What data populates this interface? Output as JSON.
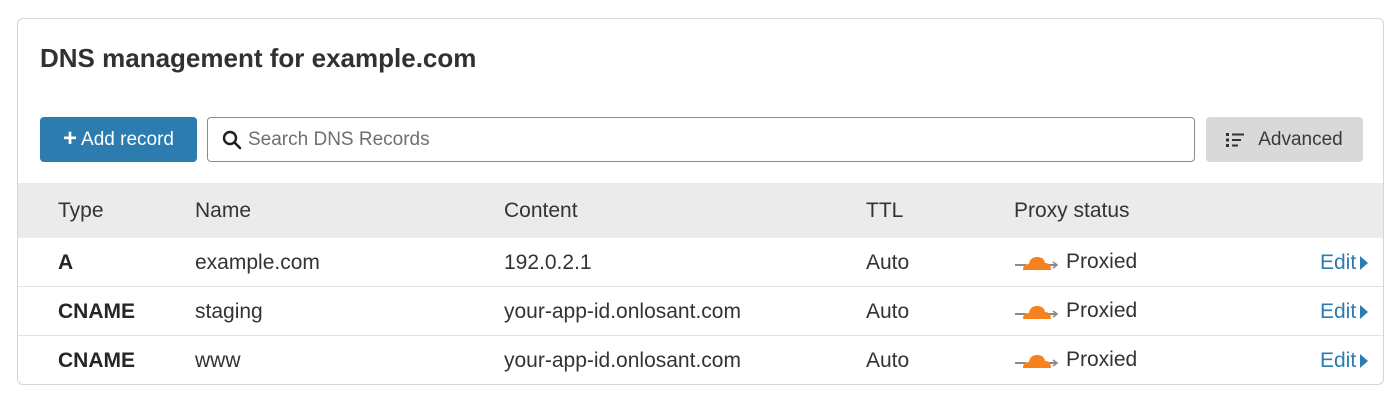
{
  "header": {
    "title_prefix": "DNS management for",
    "domain": "example.com"
  },
  "toolbar": {
    "add_record_label": "Add record",
    "search_placeholder": "Search DNS Records",
    "search_value": "",
    "advanced_label": "Advanced"
  },
  "table": {
    "columns": {
      "type": "Type",
      "name": "Name",
      "content": "Content",
      "ttl": "TTL",
      "proxy_status": "Proxy status"
    },
    "rows": [
      {
        "type": "A",
        "name": "example.com",
        "content": "192.0.2.1",
        "ttl": "Auto",
        "proxy_status": "Proxied",
        "edit": "Edit"
      },
      {
        "type": "CNAME",
        "name": "staging",
        "content": "your-app-id.onlosant.com",
        "ttl": "Auto",
        "proxy_status": "Proxied",
        "edit": "Edit"
      },
      {
        "type": "CNAME",
        "name": "www",
        "content": "your-app-id.onlosant.com",
        "ttl": "Auto",
        "proxy_status": "Proxied",
        "edit": "Edit"
      }
    ]
  },
  "colors": {
    "primary": "#2c7cb0",
    "cloud_orange": "#f6821f",
    "header_bg": "#ebebeb",
    "advanced_bg": "#d9d9d9"
  },
  "icons": {
    "add": "plus-icon",
    "search": "search-icon",
    "advanced": "filter-list-icon",
    "proxy": "cloud-icon",
    "edit": "caret-right-icon"
  }
}
